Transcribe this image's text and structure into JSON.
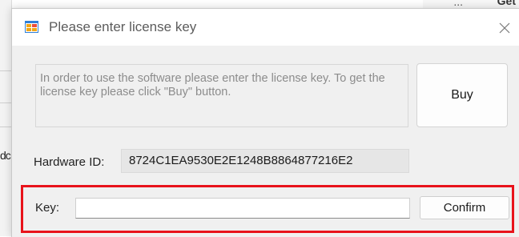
{
  "background": {
    "left_text": "dc",
    "top_right_dots": "...",
    "top_right_text": "Get"
  },
  "dialog": {
    "title": "Please enter license key",
    "close_icon": "close-icon",
    "app_icon": "windows-form-icon"
  },
  "info": {
    "text": "In order to use the software please enter the license key. To get the license key please click \"Buy\" button."
  },
  "buy_button": {
    "label": "Buy"
  },
  "hardware": {
    "label": "Hardware ID:",
    "value": "8724C1EA9530E2E1248B8864877216E2"
  },
  "key": {
    "label": "Key:",
    "value": "",
    "placeholder": ""
  },
  "confirm_button": {
    "label": "Confirm"
  },
  "colors": {
    "highlight": "#e8131b",
    "dialog_bg": "#f0f0f0",
    "info_text": "#8c8c8c"
  }
}
